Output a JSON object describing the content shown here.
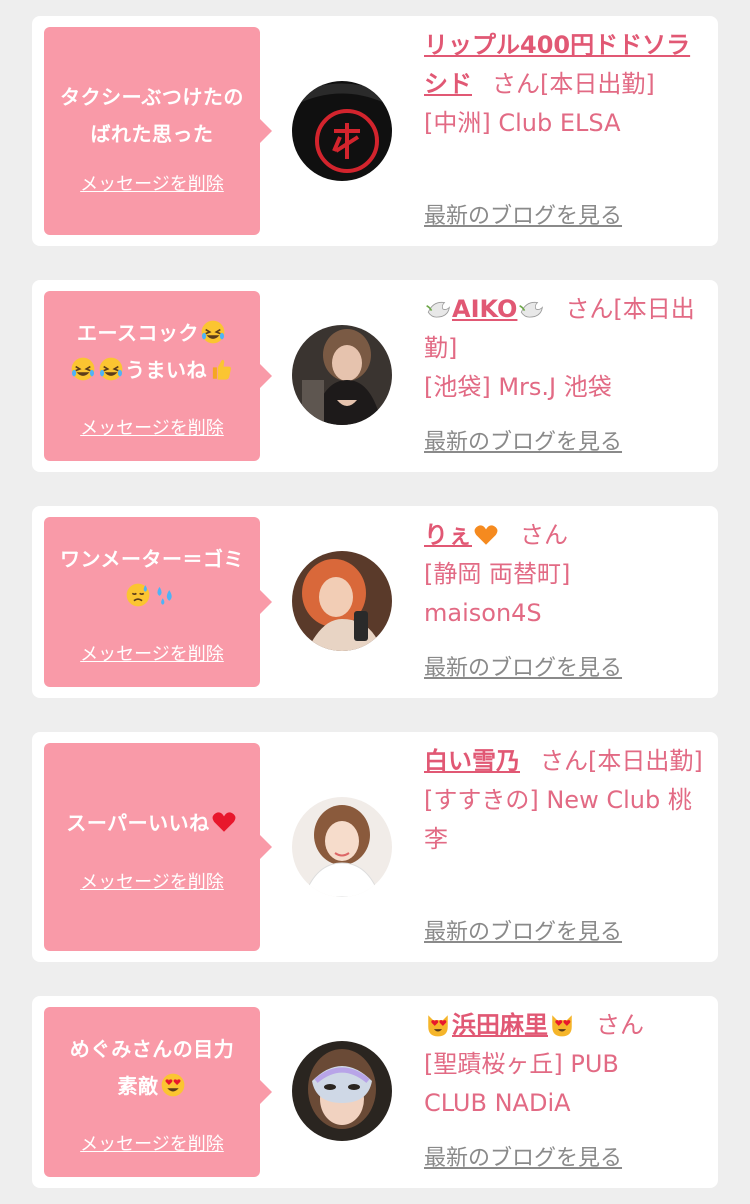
{
  "delete_label": "メッセージを削除",
  "blog_label": "最新のブログを見る",
  "entries": [
    {
      "message": "タクシーぶつけたのばれた思った",
      "name": "リップル400円ドドソラシド",
      "suffix": "さん[本日出勤]",
      "shop": "[中洲] Club ELSA",
      "avatar": "avatar-kanji-mask"
    },
    {
      "message_parts": [
        "エースコック",
        "うまいね"
      ],
      "name_core": "AIKO",
      "suffix": "さん[本日出勤]",
      "shop": "[池袋] Mrs.J 池袋",
      "avatar": "avatar-woman-dark"
    },
    {
      "message_parts": [
        "ワンメーター＝ゴミ"
      ],
      "name_core": "りぇ",
      "suffix": "さん",
      "shop": "[静岡 両替町] maison4S",
      "avatar": "avatar-woman-red-hair"
    },
    {
      "message_parts": [
        "スーパーいいね"
      ],
      "name": "白い雪乃",
      "suffix": "さん[本日出勤]",
      "shop": "[すすきの] New Club 桃李",
      "avatar": "avatar-woman-light"
    },
    {
      "message_parts": [
        "めぐみさんの目力素敵"
      ],
      "name_core": "浜田麻里",
      "suffix": "さん",
      "shop": "[聖蹟桜ヶ丘] PUB CLUB NADiA",
      "avatar": "avatar-woman-mask"
    }
  ],
  "colors": {
    "bubble": "#f99aa8",
    "accent": "#e15874",
    "link_gray": "#8a8a8a",
    "background": "#eeeeee"
  }
}
